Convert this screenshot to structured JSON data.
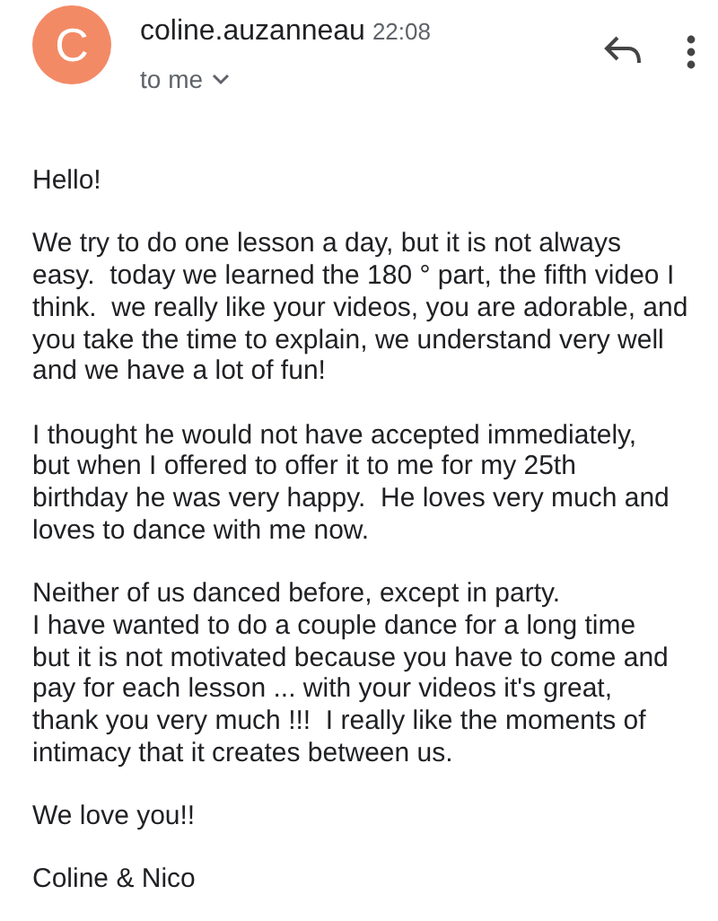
{
  "header": {
    "avatar_letter": "C",
    "sender": "coline.auzanneau",
    "time": "22:08",
    "recipient": "to me"
  },
  "body": [
    [
      "Hello!"
    ],
    [
      "We try to do one lesson a day, but it is not always",
      "easy.  today we learned the 180 ° part, the fifth video I",
      "think.  we really like your videos, you are adorable, and",
      "you take the time to explain, we understand very well",
      "and we have a lot of fun!"
    ],
    [
      "I thought he would not have accepted immediately,",
      "but when I offered to offer it to me for my 25th",
      "birthday he was very happy.  He loves very much and",
      "loves to dance with me now."
    ],
    [
      "Neither of us danced before, except in party.",
      "I have wanted to do a couple dance for a long time",
      "but it is not motivated because you have to come and",
      "pay for each lesson ... with your videos it's great,",
      "thank you very much !!!  I really like the moments of",
      "intimacy that it creates between us."
    ],
    [
      "We love you!!"
    ],
    [
      "Coline & Nico"
    ]
  ]
}
